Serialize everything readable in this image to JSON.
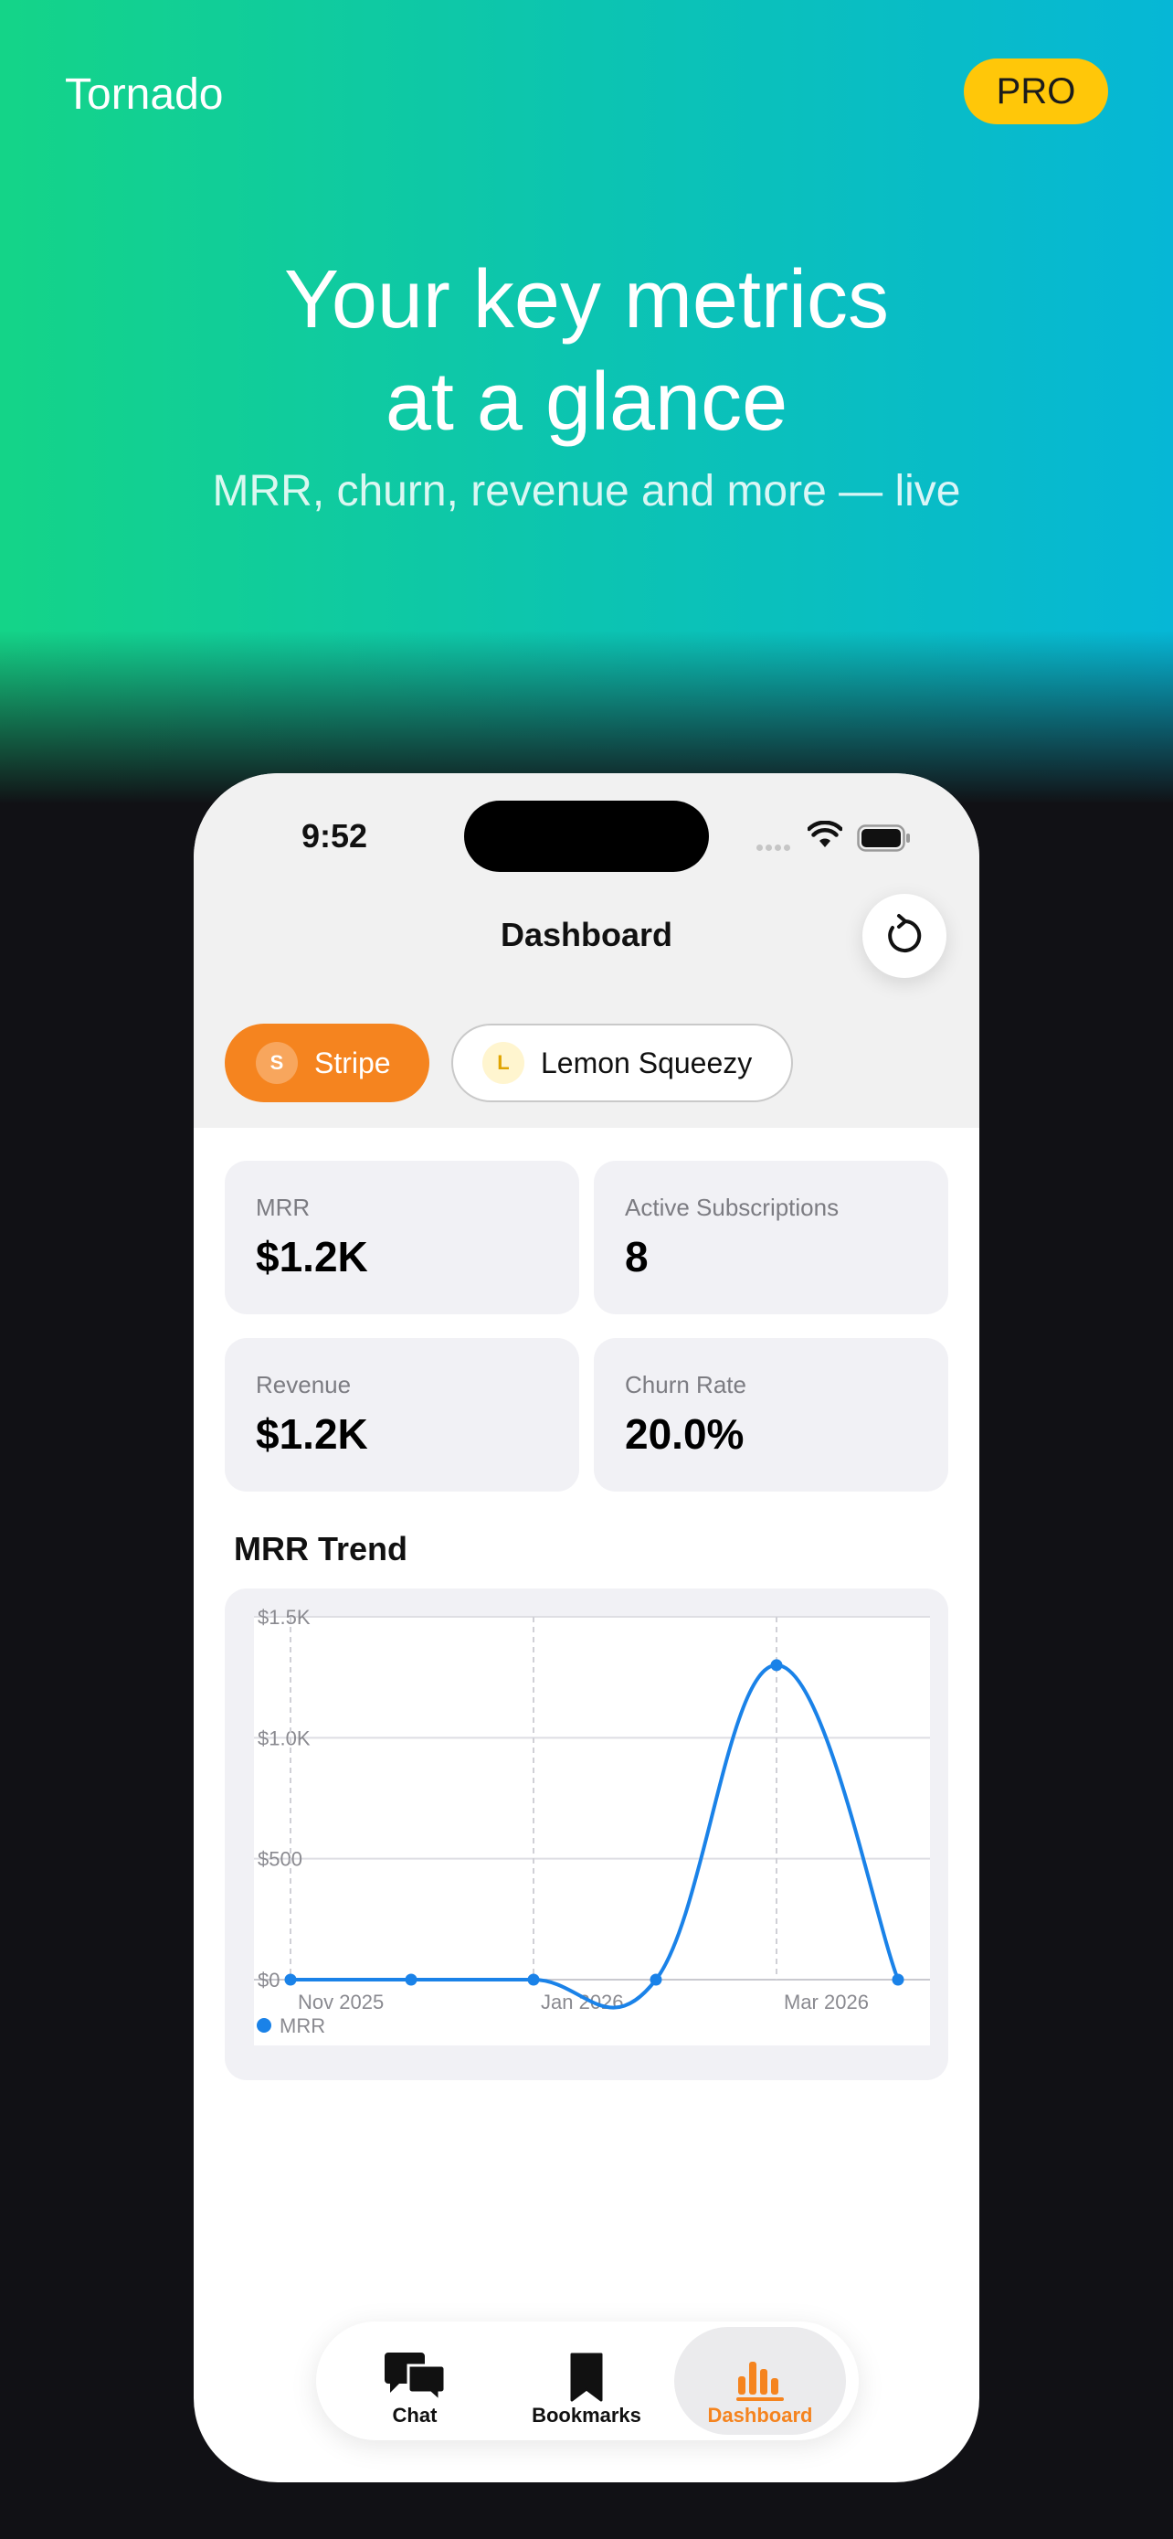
{
  "hero": {
    "brand": "Tornado",
    "badge": "PRO",
    "headline_line1": "Your key metrics",
    "headline_line2": "at a glance",
    "subheadline": "MRR, churn, revenue and more — live"
  },
  "status_bar": {
    "time": "9:52"
  },
  "nav": {
    "title": "Dashboard",
    "refresh_icon": "refresh-icon"
  },
  "providers": [
    {
      "label": "Stripe",
      "initial": "S",
      "selected": true,
      "color": "#f5841f"
    },
    {
      "label": "Lemon Squeezy",
      "initial": "L",
      "selected": false
    }
  ],
  "metrics": [
    {
      "label": "MRR",
      "value": "$1.2K"
    },
    {
      "label": "Active Subscriptions",
      "value": "8"
    },
    {
      "label": "Revenue",
      "value": "$1.2K"
    },
    {
      "label": "Churn Rate",
      "value": "20.0%"
    }
  ],
  "chart_section": {
    "title": "MRR Trend"
  },
  "chart_data": {
    "type": "line",
    "x": [
      "2025-10",
      "2025-11",
      "2025-12",
      "2026-01",
      "2026-02",
      "2026-03"
    ],
    "series": [
      {
        "name": "MRR",
        "values": [
          0,
          0,
          0,
          0,
          1300,
          0
        ],
        "color": "#1a82e8"
      }
    ],
    "y_ticks": [
      "$0",
      "$500",
      "$1.0K",
      "$1.5K"
    ],
    "y_tick_values": [
      0,
      500,
      1000,
      1500
    ],
    "x_tick_labels": [
      {
        "label": "Nov 2025",
        "at": 0
      },
      {
        "label": "Jan 2026",
        "at": 2
      },
      {
        "label": "Mar 2026",
        "at": 4
      }
    ],
    "ylim": [
      0,
      1500
    ],
    "legend": "bottom-left",
    "grid": true
  },
  "tabs": [
    {
      "label": "Chat",
      "icon": "chat-bubbles-icon",
      "active": false
    },
    {
      "label": "Bookmarks",
      "icon": "bookmark-icon",
      "active": false
    },
    {
      "label": "Dashboard",
      "icon": "bar-chart-icon",
      "active": true,
      "color": "#f5841f"
    }
  ]
}
